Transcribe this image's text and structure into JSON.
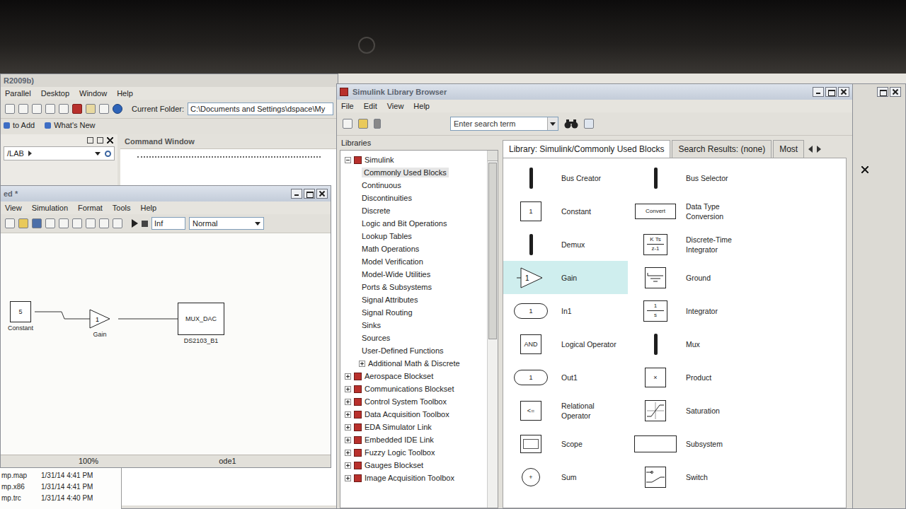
{
  "matlab": {
    "title": "R2009b)",
    "menu": [
      "Parallel",
      "Desktop",
      "Window",
      "Help"
    ],
    "current_folder_label": "Current Folder:",
    "current_folder": "C:\\Documents and Settings\\dspace\\My",
    "shortcuts": [
      "to Add",
      "What's New"
    ],
    "folder_path": "/LAB",
    "command_window": {
      "title": "Command Window"
    }
  },
  "model": {
    "title": "ed *",
    "menu": [
      "View",
      "Simulation",
      "Format",
      "Tools",
      "Help"
    ],
    "stop_time": "Inf",
    "mode": "Normal",
    "blocks": [
      {
        "kind": "constant",
        "glyph": "5",
        "label": "Constant"
      },
      {
        "kind": "gain",
        "glyph": "1",
        "label": "Gain"
      },
      {
        "kind": "dac",
        "glyph": "MUX_DAC",
        "label": "DS2103_B1"
      }
    ],
    "status": {
      "zoom": "100%",
      "solver": "ode1"
    }
  },
  "files": [
    {
      "name": "mp.map",
      "date": "1/31/14 4:41 PM"
    },
    {
      "name": "mp.x86",
      "date": "1/31/14 4:41 PM"
    },
    {
      "name": "mp.trc",
      "date": "1/31/14 4:40 PM"
    }
  ],
  "library_browser": {
    "title": "Simulink Library Browser",
    "menu": [
      "File",
      "Edit",
      "View",
      "Help"
    ],
    "search": {
      "placeholder": "Enter search term"
    },
    "libraries_label": "Libraries",
    "tree": [
      {
        "label": "Simulink",
        "kind": "library",
        "has_children": true,
        "expanded": true,
        "selected": false
      },
      {
        "label": "Commonly Used Blocks",
        "kind": "sublibrary",
        "has_children": false,
        "expanded": false,
        "selected": true
      },
      {
        "label": "Continuous",
        "kind": "sublibrary",
        "has_children": false,
        "expanded": false,
        "selected": false
      },
      {
        "label": "Discontinuities",
        "kind": "sublibrary",
        "has_children": false,
        "expanded": false,
        "selected": false
      },
      {
        "label": "Discrete",
        "kind": "sublibrary",
        "has_children": false,
        "expanded": false,
        "selected": false
      },
      {
        "label": "Logic and Bit Operations",
        "kind": "sublibrary",
        "has_children": false,
        "expanded": false,
        "selected": false
      },
      {
        "label": "Lookup Tables",
        "kind": "sublibrary",
        "has_children": false,
        "expanded": false,
        "selected": false
      },
      {
        "label": "Math Operations",
        "kind": "sublibrary",
        "has_children": false,
        "expanded": false,
        "selected": false
      },
      {
        "label": "Model Verification",
        "kind": "sublibrary",
        "has_children": false,
        "expanded": false,
        "selected": false
      },
      {
        "label": "Model-Wide Utilities",
        "kind": "sublibrary",
        "has_children": false,
        "expanded": false,
        "selected": false
      },
      {
        "label": "Ports & Subsystems",
        "kind": "sublibrary",
        "has_children": false,
        "expanded": false,
        "selected": false
      },
      {
        "label": "Signal Attributes",
        "kind": "sublibrary",
        "has_children": false,
        "expanded": false,
        "selected": false
      },
      {
        "label": "Signal Routing",
        "kind": "sublibrary",
        "has_children": false,
        "expanded": false,
        "selected": false
      },
      {
        "label": "Sinks",
        "kind": "sublibrary",
        "has_children": false,
        "expanded": false,
        "selected": false
      },
      {
        "label": "Sources",
        "kind": "sublibrary",
        "has_children": false,
        "expanded": false,
        "selected": false
      },
      {
        "label": "User-Defined Functions",
        "kind": "sublibrary",
        "has_children": false,
        "expanded": false,
        "selected": false
      },
      {
        "label": "Additional Math & Discrete",
        "kind": "sublibrary",
        "has_children": true,
        "expanded": false,
        "selected": false
      },
      {
        "label": "Aerospace Blockset",
        "kind": "library",
        "has_children": true,
        "expanded": false,
        "selected": false
      },
      {
        "label": "Communications Blockset",
        "kind": "library",
        "has_children": true,
        "expanded": false,
        "selected": false
      },
      {
        "label": "Control System Toolbox",
        "kind": "library",
        "has_children": true,
        "expanded": false,
        "selected": false
      },
      {
        "label": "Data Acquisition Toolbox",
        "kind": "library",
        "has_children": true,
        "expanded": false,
        "selected": false
      },
      {
        "label": "EDA Simulator Link",
        "kind": "library",
        "has_children": true,
        "expanded": false,
        "selected": false
      },
      {
        "label": "Embedded IDE Link",
        "kind": "library",
        "has_children": true,
        "expanded": false,
        "selected": false
      },
      {
        "label": "Fuzzy Logic Toolbox",
        "kind": "library",
        "has_children": true,
        "expanded": false,
        "selected": false
      },
      {
        "label": "Gauges Blockset",
        "kind": "library",
        "has_children": true,
        "expanded": false,
        "selected": false
      },
      {
        "label": "Image Acquisition Toolbox",
        "kind": "library",
        "has_children": true,
        "expanded": false,
        "selected": false
      }
    ],
    "tabs": [
      {
        "label": "Library: Simulink/Commonly Used Blocks",
        "selected": true
      },
      {
        "label": "Search Results: (none)",
        "selected": false
      },
      {
        "label": "Most",
        "selected": false
      }
    ],
    "blocks": [
      {
        "name": "Bus Creator",
        "kind": "bar",
        "glyph": "",
        "selected": false
      },
      {
        "name": "Bus Selector",
        "kind": "bar",
        "glyph": "",
        "selected": false
      },
      {
        "name": "Constant",
        "kind": "box",
        "glyph": "1",
        "selected": false
      },
      {
        "name": "Data Type Conversion",
        "kind": "wide-box",
        "glyph": "Convert",
        "selected": false
      },
      {
        "name": "Demux",
        "kind": "bar",
        "glyph": "",
        "selected": false
      },
      {
        "name": "Discrete-Time Integrator",
        "kind": "fraction",
        "glyph": "K Ts",
        "denominator": "z-1",
        "selected": false
      },
      {
        "name": "Gain",
        "kind": "triangle",
        "glyph": "1",
        "selected": true
      },
      {
        "name": "Ground",
        "kind": "ground",
        "glyph": "",
        "selected": false
      },
      {
        "name": "In1",
        "kind": "port-in",
        "glyph": "1",
        "selected": false
      },
      {
        "name": "Integrator",
        "kind": "fraction",
        "glyph": "1",
        "denominator": "s",
        "selected": false
      },
      {
        "name": "Logical Operator",
        "kind": "box",
        "glyph": "AND",
        "selected": false
      },
      {
        "name": "Mux",
        "kind": "bar",
        "glyph": "",
        "selected": false
      },
      {
        "name": "Out1",
        "kind": "port-out",
        "glyph": "1",
        "selected": false
      },
      {
        "name": "Product",
        "kind": "box",
        "glyph": "×",
        "selected": false
      },
      {
        "name": "Relational Operator",
        "kind": "box",
        "glyph": "<=",
        "selected": false
      },
      {
        "name": "Saturation",
        "kind": "saturation",
        "glyph": "",
        "selected": false
      },
      {
        "name": "Scope",
        "kind": "scope",
        "glyph": "",
        "selected": false
      },
      {
        "name": "Subsystem",
        "kind": "subsystem",
        "glyph": "",
        "selected": false
      },
      {
        "name": "Sum",
        "kind": "circle",
        "glyph": "+",
        "selected": false
      },
      {
        "name": "Switch",
        "kind": "switch",
        "glyph": "",
        "selected": false
      }
    ]
  }
}
